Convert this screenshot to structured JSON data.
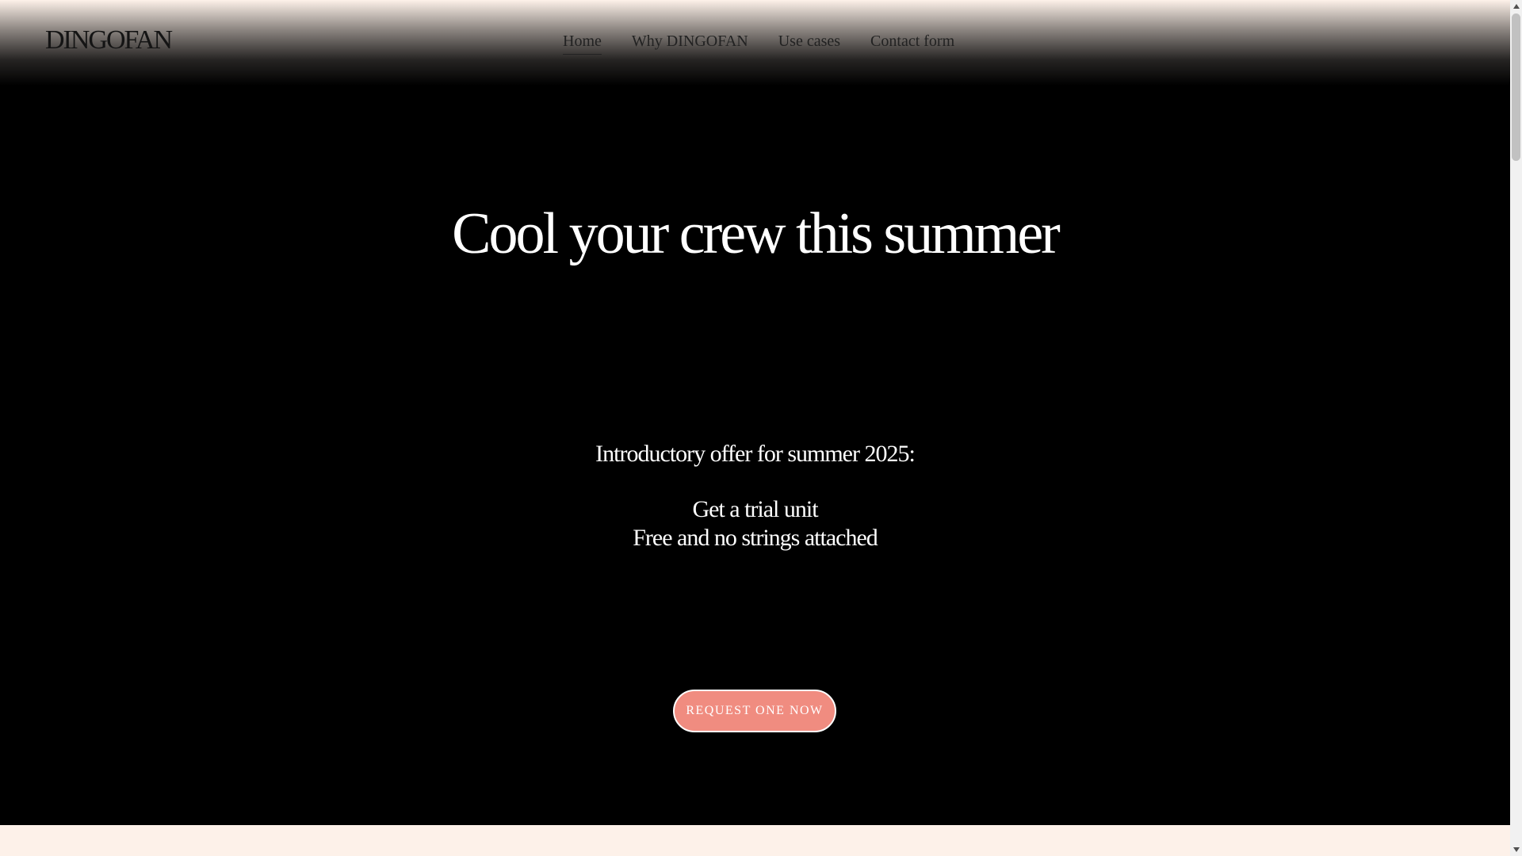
{
  "header": {
    "logo": "DINGOFAN",
    "nav": [
      {
        "label": "Home",
        "active": true
      },
      {
        "label": "Why DINGOFAN",
        "active": false
      },
      {
        "label": "Use cases",
        "active": false
      },
      {
        "label": "Contact form",
        "active": false
      }
    ]
  },
  "hero": {
    "headline": "Cool your crew this summer",
    "offer_intro": "Introductory offer for summer 2025:",
    "offer_line1": "Get a trial unit",
    "offer_line2": "Free and no strings attached",
    "cta_label": "REQUEST ONE NOW"
  },
  "colors": {
    "hero_background": "#000000",
    "header_tint": "#fdf1e9",
    "cta_background": "#f08c80",
    "section_background": "#fdf1e9"
  },
  "scrollbar": {
    "up_icon": "chevron-up-icon",
    "down_icon": "chevron-down-icon"
  }
}
